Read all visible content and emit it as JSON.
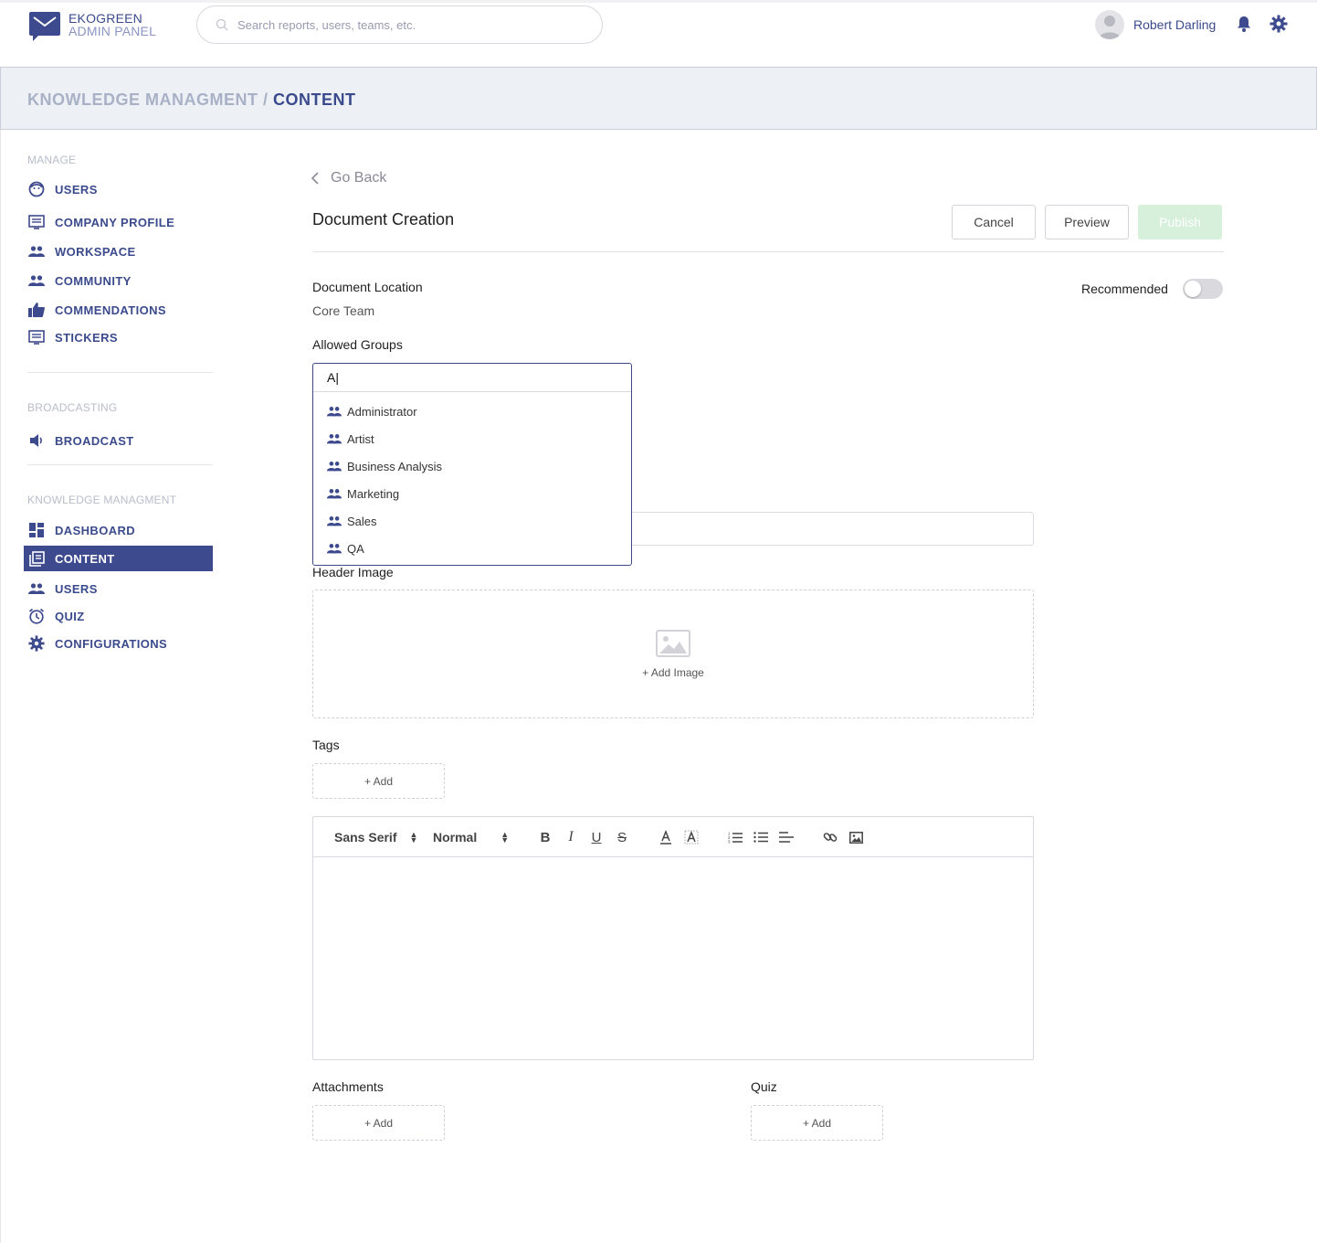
{
  "header": {
    "brand_line1": "EKOGREEN",
    "brand_line2": "ADMIN PANEL",
    "search_placeholder": "Search reports, users, teams, etc.",
    "user_name": "Robert Darling"
  },
  "breadcrumb": {
    "parent": "KNOWLEDGE MANAGMENT",
    "separator": "/",
    "current": "CONTENT"
  },
  "sidebar": {
    "manage_title": "MANAGE",
    "manage_items": [
      {
        "label": "USERS",
        "icon": "face-icon"
      },
      {
        "label": "COMPANY PROFILE",
        "icon": "profile-card-icon"
      },
      {
        "label": "WORKSPACE",
        "icon": "people-icon"
      },
      {
        "label": "COMMUNITY",
        "icon": "people-icon"
      },
      {
        "label": "COMMENDATIONS",
        "icon": "thumbs-up-icon"
      },
      {
        "label": "STICKERS",
        "icon": "sticker-icon"
      }
    ],
    "broadcasting_title": "BROADCASTING",
    "broadcasting_items": [
      {
        "label": "BROADCAST",
        "icon": "speaker-icon"
      }
    ],
    "km_title": "KNOWLEDGE MANAGMENT",
    "km_items": [
      {
        "label": "DASHBOARD",
        "icon": "dashboard-icon"
      },
      {
        "label": "CONTENT",
        "icon": "content-icon",
        "active": true
      },
      {
        "label": "USERS",
        "icon": "people-icon"
      },
      {
        "label": "QUIZ",
        "icon": "clock-icon"
      },
      {
        "label": "CONFIGURATIONS",
        "icon": "gear-icon"
      }
    ]
  },
  "main": {
    "go_back": "Go Back",
    "title": "Document Creation",
    "buttons": {
      "cancel": "Cancel",
      "preview": "Preview",
      "publish": "Publish"
    },
    "document_location_label": "Document Location",
    "document_location_value": "Core Team",
    "recommended_label": "Recommended",
    "recommended_on": false,
    "allowed_groups_label": "Allowed Groups",
    "allowed_groups_query": "A|",
    "group_options": [
      "Administrator",
      "Artist",
      "Business Analysis",
      "Marketing",
      "Sales",
      "QA"
    ],
    "header_image_label": "Header Image",
    "add_image_label": "+ Add Image",
    "tags_label": "Tags",
    "add_label": "+ Add",
    "editor": {
      "font": "Sans Serif",
      "size": "Normal",
      "tools": [
        "bold-icon",
        "italic-icon",
        "underline-icon",
        "strikethrough-icon",
        "text-color-icon",
        "highlight-icon",
        "ordered-list-icon",
        "bullet-list-icon",
        "align-icon",
        "link-icon",
        "image-icon"
      ]
    },
    "attachments_label": "Attachments",
    "quiz_label": "Quiz"
  },
  "colors": {
    "primary": "#3d4a8e",
    "muted_label": "#b9bdca",
    "publish_disabled": "#d6f0dc",
    "band_bg": "#edf1f6"
  }
}
